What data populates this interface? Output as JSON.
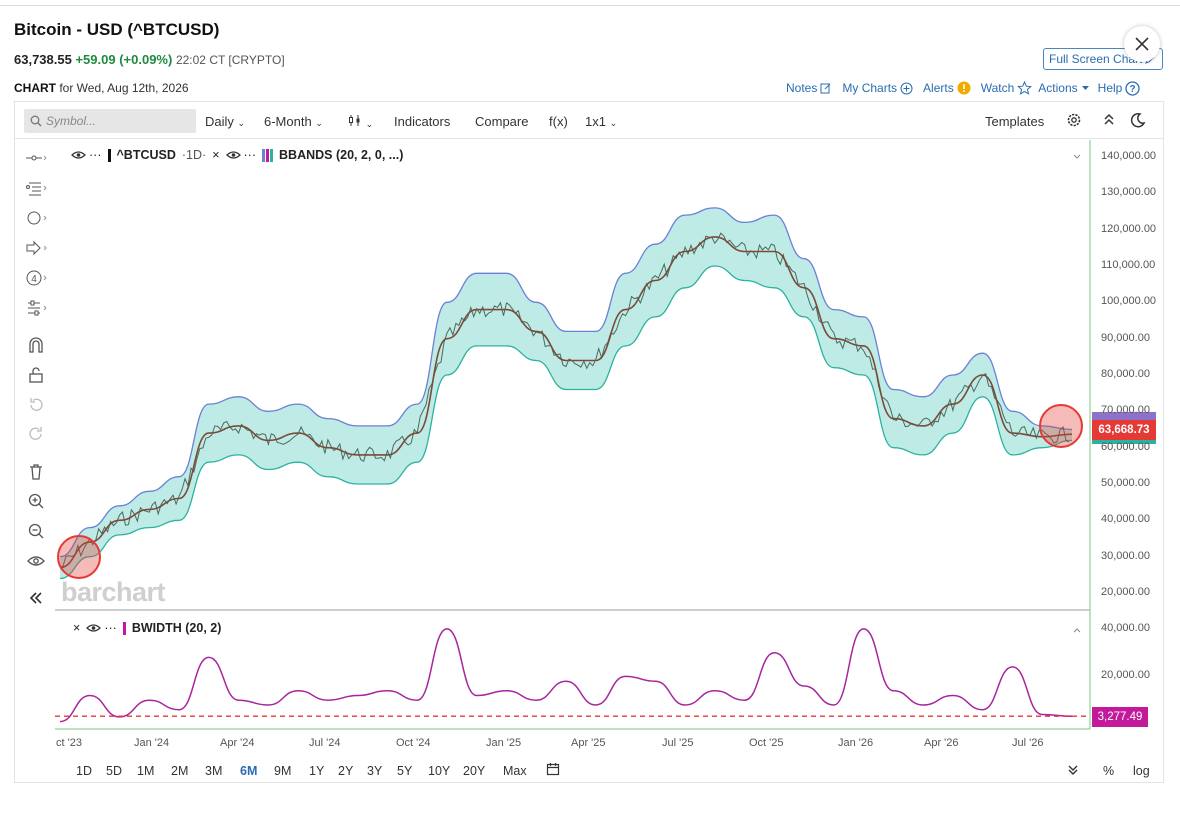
{
  "header": {
    "title": "Bitcoin - USD (^BTCUSD)",
    "price": "63,738.55",
    "change": "+59.09 (+0.09%)",
    "time": "22:02 CT [CRYPTO]",
    "chart_label": "CHART",
    "chart_date": "for Wed, Aug 12th, 2026",
    "fullscreen_label": "Full Screen Chart"
  },
  "top_links": {
    "notes": "Notes",
    "my_charts": "My Charts",
    "alerts": "Alerts",
    "watch": "Watch",
    "actions": "Actions",
    "help": "Help"
  },
  "toolbar": {
    "symbol_placeholder": "Symbol...",
    "period": "Daily",
    "range": "6-Month",
    "chart_type_icon": "candle-icon",
    "indicators": "Indicators",
    "compare": "Compare",
    "fx": "f(x)",
    "layout": "1x1",
    "templates": "Templates"
  },
  "legend_main": {
    "symbol": "^BTCUSD",
    "interval": "·1D·",
    "study": "BBANDS (20, 2, 0, ...)"
  },
  "legend_lower": {
    "study": "BWIDTH (20, 2)"
  },
  "watermark": "barchart",
  "price_tag": "63,668.73",
  "bw_tag": "3,277.49",
  "bottom_ranges": [
    "1D",
    "5D",
    "1M",
    "2M",
    "3M",
    "6M",
    "9M",
    "1Y",
    "2Y",
    "3Y",
    "5Y",
    "10Y",
    "20Y",
    "Max"
  ],
  "active_range": "6M",
  "bottom_right": {
    "percent": "%",
    "log": "log"
  },
  "colors": {
    "accent": "#2a6db0",
    "up": "#1f8a3e",
    "band_fill": "#a8e4de",
    "band_line": "#6d7fd6",
    "mid_line": "#7a4a3a",
    "price_tag": "#e53935",
    "bw_line": "#a8269d"
  },
  "chart_data": [
    {
      "type": "line",
      "title": "^BTCUSD",
      "ylim": [
        20000,
        140000
      ],
      "y_ticks": [
        "140,000.00",
        "130,000.00",
        "120,000.00",
        "110,000.00",
        "100,000.00",
        "90,000.00",
        "80,000.00",
        "70,000.00",
        "60,000.00",
        "50,000.00",
        "40,000.00",
        "30,000.00",
        "20,000.00"
      ],
      "x_ticks": [
        "ct '23",
        "Jan '24",
        "Apr '24",
        "Jul '24",
        "Oct '24",
        "Jan '25",
        "Apr '25",
        "Jul '25",
        "Oct '25",
        "Jan '26",
        "Apr '26",
        "Jul '26"
      ],
      "x": [
        "2023-10",
        "2023-11",
        "2023-12",
        "2024-01",
        "2024-02",
        "2024-03",
        "2024-04",
        "2024-05",
        "2024-06",
        "2024-07",
        "2024-08",
        "2024-09",
        "2024-10",
        "2024-11",
        "2024-12",
        "2025-01",
        "2025-02",
        "2025-03",
        "2025-04",
        "2025-05",
        "2025-06",
        "2025-07",
        "2025-08",
        "2025-09",
        "2025-10",
        "2025-11",
        "2025-12",
        "2026-01",
        "2026-02",
        "2026-03",
        "2026-04",
        "2026-05",
        "2026-06",
        "2026-07",
        "2026-08"
      ],
      "series": [
        {
          "values": [
            27000,
            34000,
            40000,
            43000,
            46000,
            64000,
            66000,
            62000,
            64000,
            60000,
            58000,
            58000,
            64000,
            90000,
            98000,
            98000,
            92000,
            84000,
            84000,
            98000,
            106000,
            114000,
            118000,
            114000,
            114000,
            104000,
            90000,
            88000,
            68000,
            66000,
            72000,
            80000,
            64000,
            63000,
            63700
          ]
        },
        {
          "values": [
            30000,
            38000,
            44000,
            48000,
            52000,
            72000,
            74000,
            70000,
            72000,
            68000,
            66000,
            66000,
            72000,
            100000,
            108000,
            108000,
            100000,
            92000,
            92000,
            108000,
            116000,
            124000,
            126000,
            122000,
            124000,
            112000,
            98000,
            96000,
            76000,
            74000,
            80000,
            86000,
            70000,
            66000,
            65000
          ]
        },
        {
          "values": [
            24000,
            30000,
            36000,
            38000,
            40000,
            56000,
            58000,
            54000,
            56000,
            52000,
            50000,
            50000,
            56000,
            80000,
            88000,
            88000,
            84000,
            76000,
            76000,
            88000,
            96000,
            104000,
            110000,
            106000,
            104000,
            96000,
            82000,
            80000,
            60000,
            58000,
            64000,
            74000,
            58000,
            60000,
            62000
          ]
        }
      ]
    },
    {
      "type": "line",
      "title": "BWIDTH (20, 2)",
      "ylim": [
        0,
        45000
      ],
      "y_ticks": [
        "40,000.00",
        "20,000.00"
      ],
      "series": [
        {
          "values": [
            1000,
            12000,
            3000,
            10000,
            6000,
            28000,
            10000,
            8000,
            14000,
            10000,
            12000,
            14000,
            10000,
            40000,
            12000,
            14000,
            10000,
            18000,
            8000,
            20000,
            18000,
            8000,
            14000,
            10000,
            30000,
            16000,
            8000,
            40000,
            14000,
            8000,
            12000,
            6000,
            24000,
            4000,
            3277
          ]
        }
      ],
      "reference_line": 3277.49
    }
  ]
}
